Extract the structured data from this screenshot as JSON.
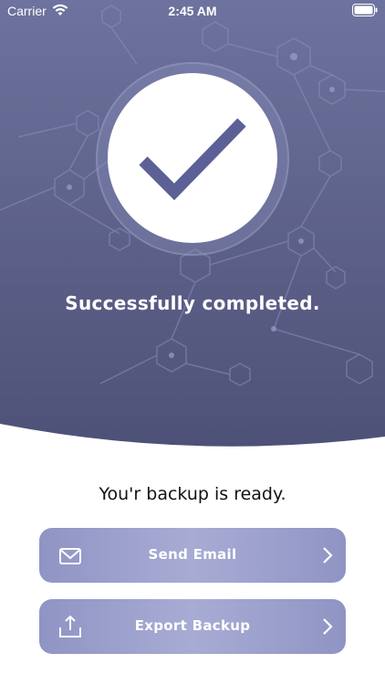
{
  "status_bar": {
    "carrier": "Carrier",
    "time": "2:45 AM",
    "wifi_icon": "wifi-icon",
    "battery_icon": "battery-full-icon"
  },
  "hero": {
    "check_icon": "checkmark-icon",
    "message": "Successfully completed."
  },
  "body": {
    "ready_message": "You'r backup is ready."
  },
  "actions": [
    {
      "label": "Send Email",
      "icon": "mail-icon",
      "trailing_icon": "chevron-right-icon"
    },
    {
      "label": "Export Backup",
      "icon": "share-upload-icon",
      "trailing_icon": "chevron-right-icon"
    }
  ],
  "colors": {
    "hero_top": "#6e749f",
    "hero_bottom": "#4f5278",
    "checkmark": "#5b6196",
    "button": "#9a9ecc",
    "text_dark": "#111111",
    "text_light": "#ffffff"
  }
}
